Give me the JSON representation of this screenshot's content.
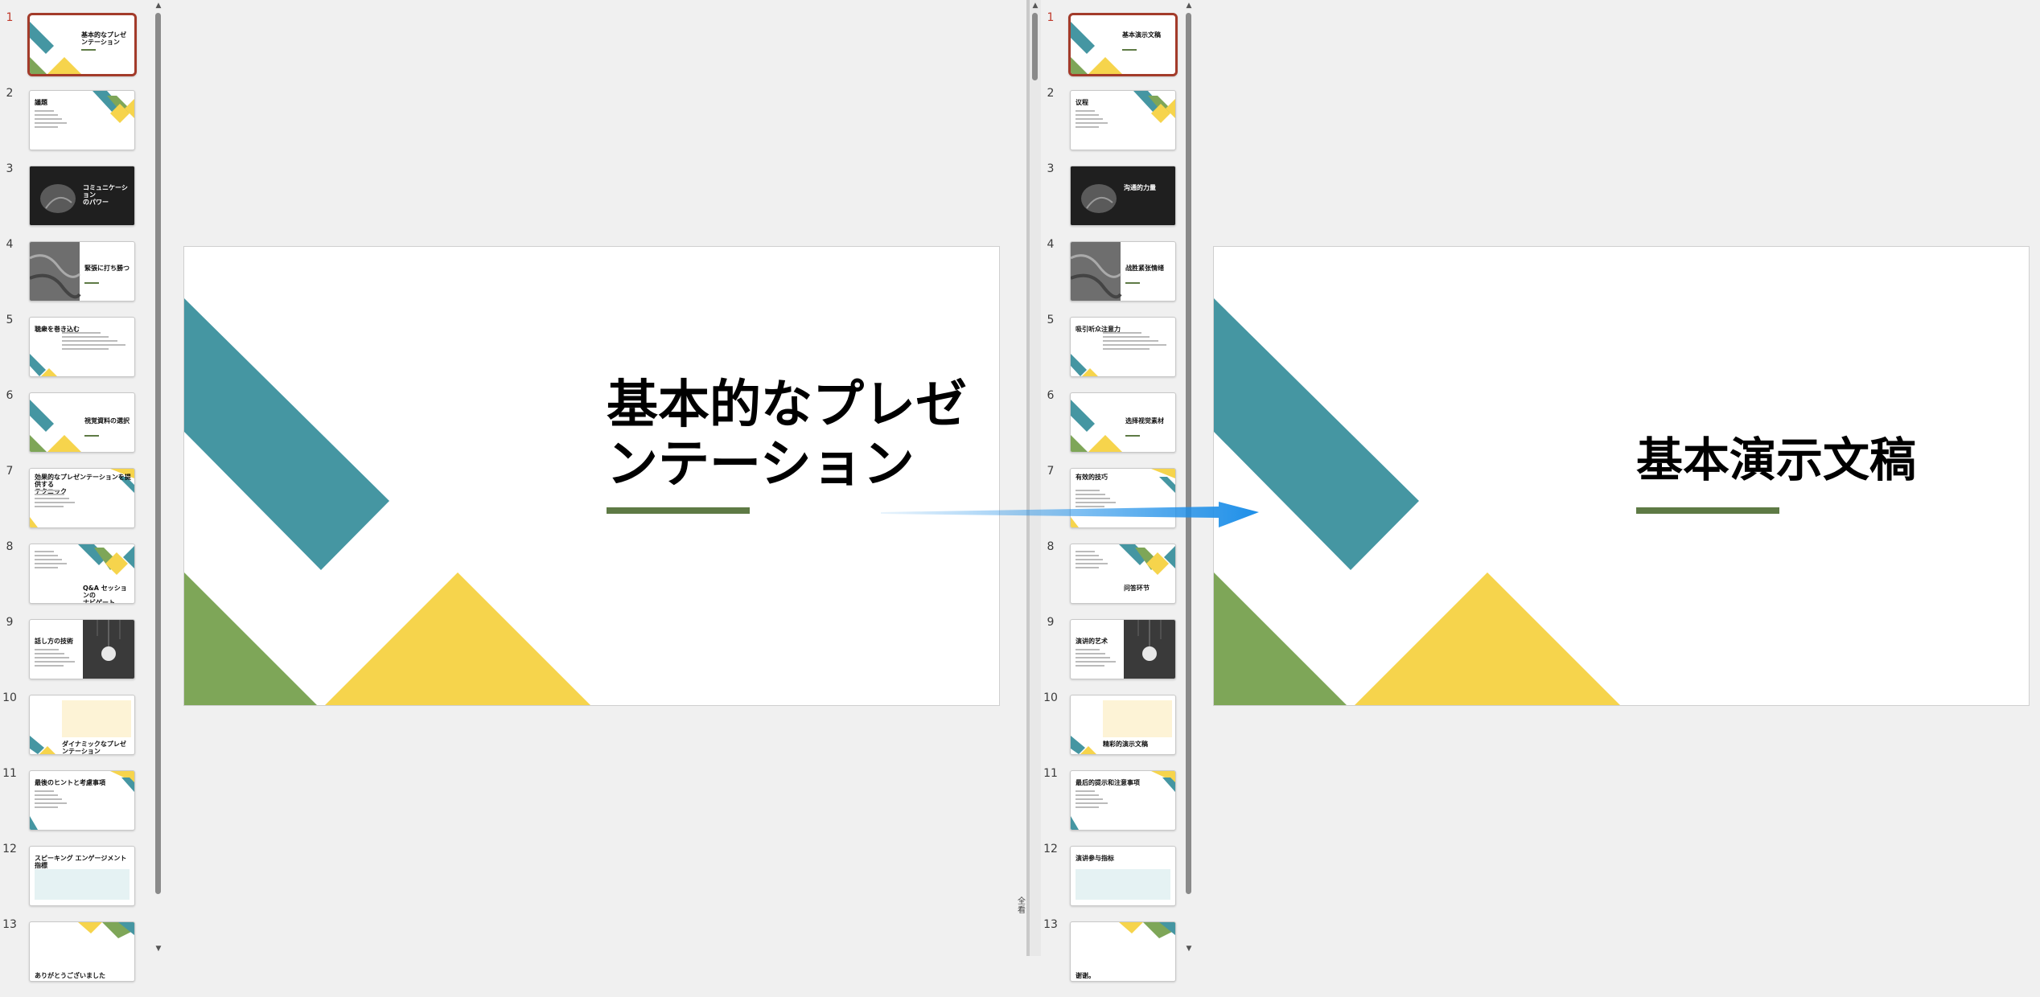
{
  "left": {
    "slides": [
      {
        "num": "1",
        "title": "基本的なプレゼ\nンテーション",
        "kind": "title",
        "active": true
      },
      {
        "num": "2",
        "title": "議題",
        "kind": "agenda"
      },
      {
        "num": "3",
        "title": "コミュニケーション\nのパワー",
        "kind": "dark"
      },
      {
        "num": "4",
        "title": "緊張に打ち勝つ",
        "kind": "photo"
      },
      {
        "num": "5",
        "title": "聴衆を巻き込む",
        "kind": "text"
      },
      {
        "num": "6",
        "title": "視覚資料の選択",
        "kind": "section"
      },
      {
        "num": "7",
        "title": "効果的なプレゼンテーションを提供する\nテクニック",
        "kind": "twocol"
      },
      {
        "num": "8",
        "title": "Q&A セッションの\nナビゲート",
        "kind": "qa"
      },
      {
        "num": "9",
        "title": "話し方の技術",
        "kind": "bulb"
      },
      {
        "num": "10",
        "title": "ダイナミックなプレゼンテーション\nの要件",
        "kind": "table"
      },
      {
        "num": "11",
        "title": "最後のヒントと考慮事項",
        "kind": "list"
      },
      {
        "num": "12",
        "title": "スピーキング エンゲージメント指標",
        "kind": "metrics"
      },
      {
        "num": "13",
        "title": "ありがとうございました",
        "kind": "end"
      }
    ],
    "main_title": "基本的なプレゼ\nンテーション"
  },
  "right": {
    "slides": [
      {
        "num": "1",
        "title": "基本演示文稿",
        "kind": "title",
        "active": true
      },
      {
        "num": "2",
        "title": "议程",
        "kind": "agenda"
      },
      {
        "num": "3",
        "title": "沟通的力量",
        "kind": "dark"
      },
      {
        "num": "4",
        "title": "战胜紧张情绪",
        "kind": "photo"
      },
      {
        "num": "5",
        "title": "吸引听众注意力",
        "kind": "text"
      },
      {
        "num": "6",
        "title": "选择视觉素材",
        "kind": "section"
      },
      {
        "num": "7",
        "title": "有效的技巧",
        "kind": "twocol"
      },
      {
        "num": "8",
        "title": "问答环节",
        "kind": "qa"
      },
      {
        "num": "9",
        "title": "演讲的艺术",
        "kind": "bulb"
      },
      {
        "num": "10",
        "title": "精彩的演示文稿",
        "kind": "table"
      },
      {
        "num": "11",
        "title": "最后的提示和注意事项",
        "kind": "list"
      },
      {
        "num": "12",
        "title": "演讲参与指标",
        "kind": "metrics"
      },
      {
        "num": "13",
        "title": "谢谢。",
        "kind": "end"
      }
    ],
    "main_title": "基本演示文稿"
  },
  "splitter_label": "全\n看",
  "colors": {
    "teal": "#4596a2",
    "green": "#7ea658",
    "yellow": "#f6d44c",
    "underline": "#5e7a45",
    "arrow": "#1e8fe8",
    "active_border": "#a33b2a"
  }
}
